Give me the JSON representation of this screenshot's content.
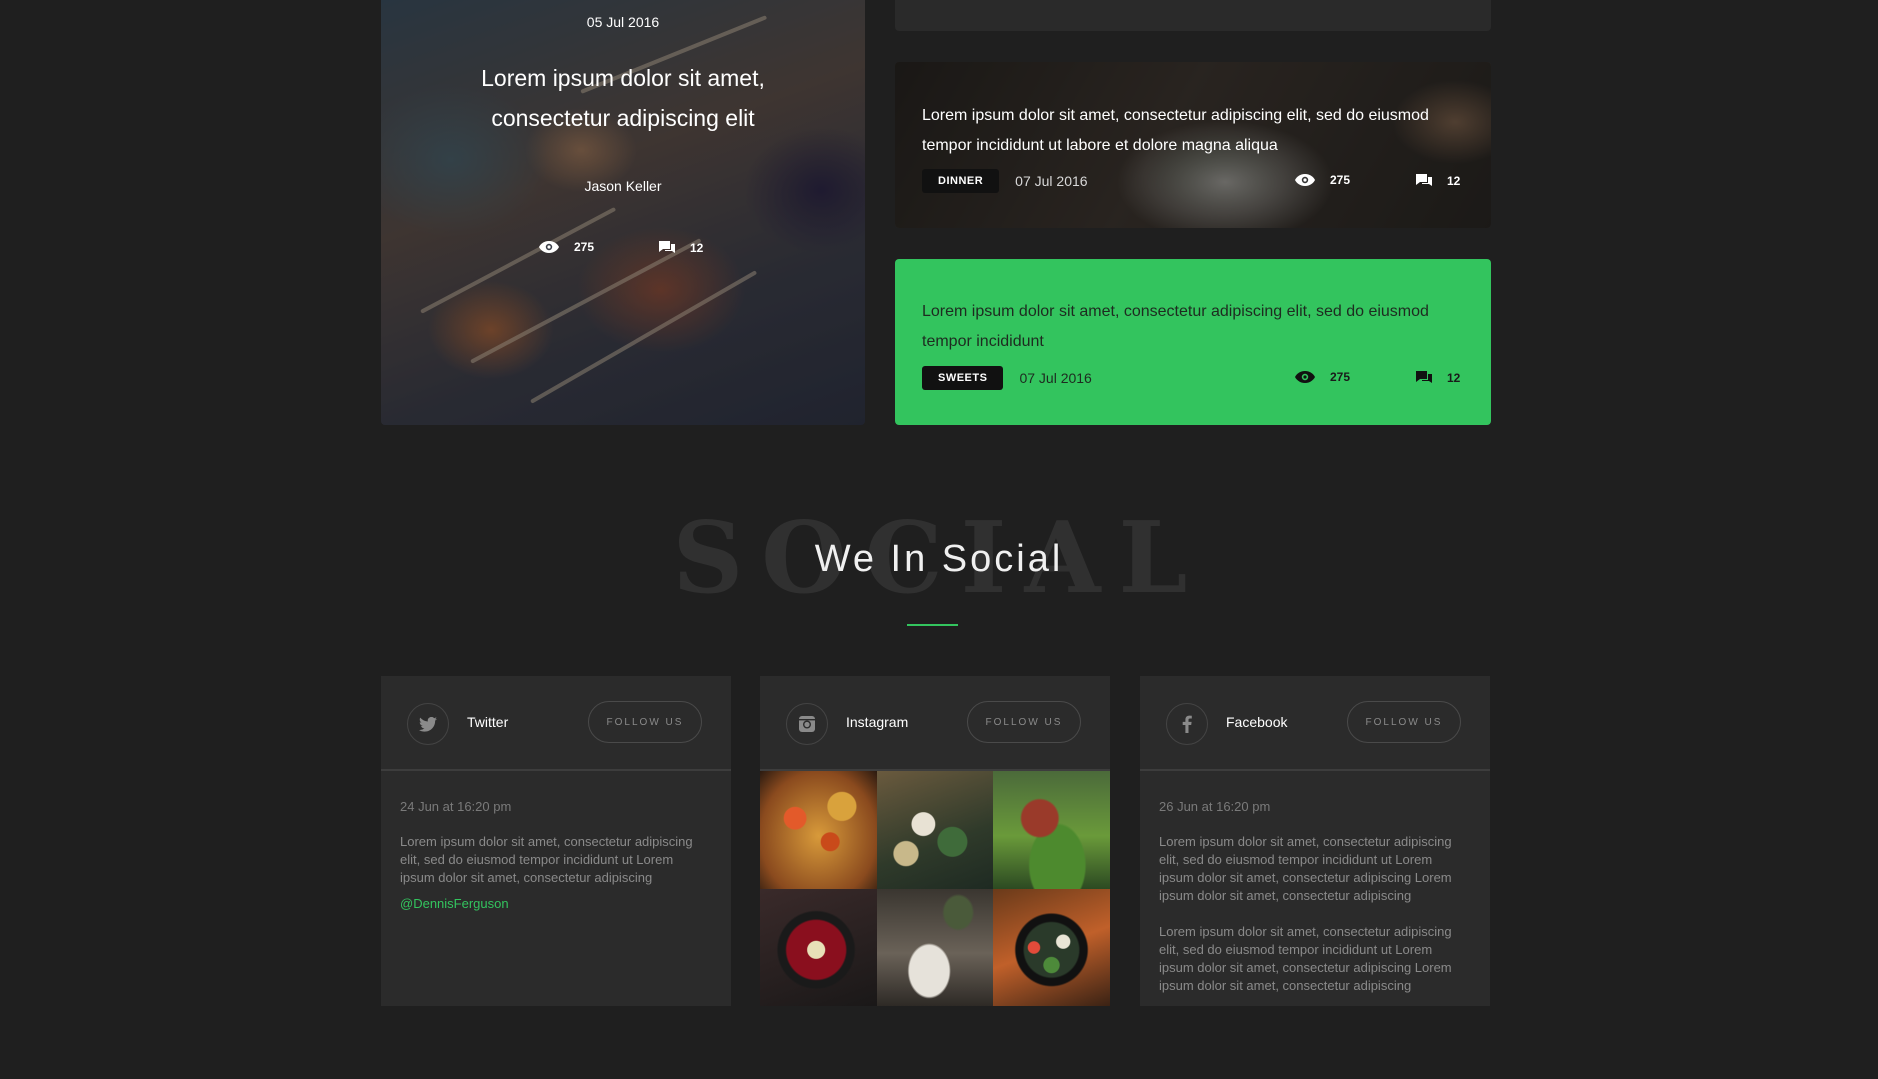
{
  "hero": {
    "date": "05 Jul 2016",
    "title": "Lorem ipsum dolor sit amet, consectetur adipiscing elit",
    "author": "Jason Keller",
    "views": "275",
    "comments": "12"
  },
  "dinner_card": {
    "text": "Lorem ipsum dolor sit amet, consectetur adipiscing elit, sed do eiusmod tempor incididunt ut labore et dolore magna aliqua",
    "tag": "DINNER",
    "date": "07 Jul 2016",
    "views": "275",
    "comments": "12"
  },
  "sweets_card": {
    "text": "Lorem ipsum dolor sit amet, consectetur adipiscing elit, sed do eiusmod tempor incididunt",
    "tag": "SWEETS",
    "date": "07 Jul 2016",
    "views": "275",
    "comments": "12"
  },
  "social_section": {
    "background_word": "SOCIAL",
    "heading": "We In Social",
    "accent_color": "#33c45e"
  },
  "twitter": {
    "name": "Twitter",
    "follow_label": "FOLLOW US",
    "time": "24 Jun at 16:20 pm",
    "text": "Lorem ipsum dolor sit amet, consectetur adipiscing elit, sed do eiusmod tempor incididunt ut Lorem ipsum dolor sit amet, consectetur adipiscing",
    "handle": "@DennisFerguson",
    "icon": "twitter-icon"
  },
  "instagram": {
    "name": "Instagram",
    "follow_label": "FOLLOW US",
    "icon": "instagram-icon",
    "photos": [
      "food-photo-1",
      "food-photo-2",
      "food-photo-3",
      "food-photo-4",
      "food-photo-5",
      "food-photo-6"
    ]
  },
  "facebook": {
    "name": "Facebook",
    "follow_label": "FOLLOW US",
    "time": "26 Jun at 16:20 pm",
    "text1": "Lorem ipsum dolor sit amet, consectetur adipiscing elit, sed do eiusmod tempor incididunt ut Lorem ipsum dolor sit amet, consectetur adipiscing Lorem ipsum dolor sit amet, consectetur adipiscing",
    "text2": "Lorem ipsum dolor sit amet, consectetur adipiscing elit, sed do eiusmod tempor incididunt ut Lorem ipsum dolor sit amet, consectetur adipiscing Lorem ipsum dolor sit amet, consectetur adipiscing",
    "icon": "facebook-icon"
  }
}
